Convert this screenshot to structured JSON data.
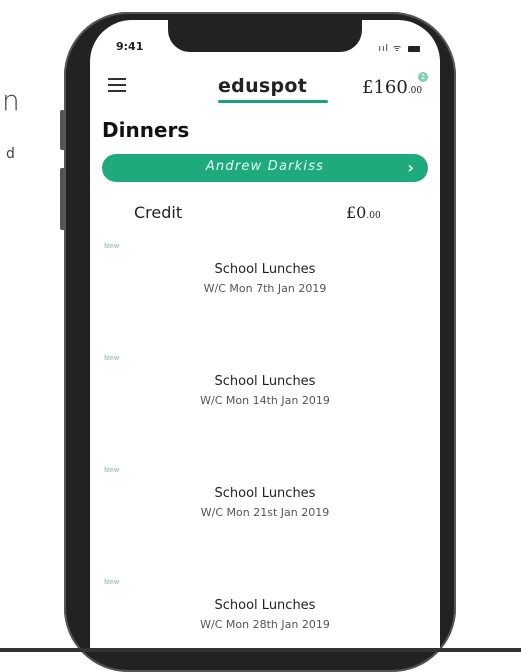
{
  "background": {
    "glyph_n": "n",
    "glyph_d": "d"
  },
  "status_bar": {
    "time": "9:41",
    "signal": "ııl",
    "wifi": "ᯤ"
  },
  "header": {
    "title": "eduspot",
    "balance_main": "£160",
    "balance_pence": ".00",
    "badge": "2",
    "accent_color": "#1aa179"
  },
  "page": {
    "title": "Dinners"
  },
  "pupil": {
    "name": "Andrew Darkiss",
    "bar_color": "#1faa7e"
  },
  "credit": {
    "label": "Credit",
    "value_main": "£0",
    "value_pence": ".00"
  },
  "weeks": [
    {
      "tag": "New",
      "title": "School Lunches",
      "date": "W/C Mon 7th Jan 2019"
    },
    {
      "tag": "New",
      "title": "School Lunches",
      "date": "W/C Mon 14th Jan 2019"
    },
    {
      "tag": "New",
      "title": "School Lunches",
      "date": "W/C Mon 21st Jan 2019"
    },
    {
      "tag": "New",
      "title": "School Lunches",
      "date": "W/C Mon 28th Jan 2019"
    }
  ]
}
